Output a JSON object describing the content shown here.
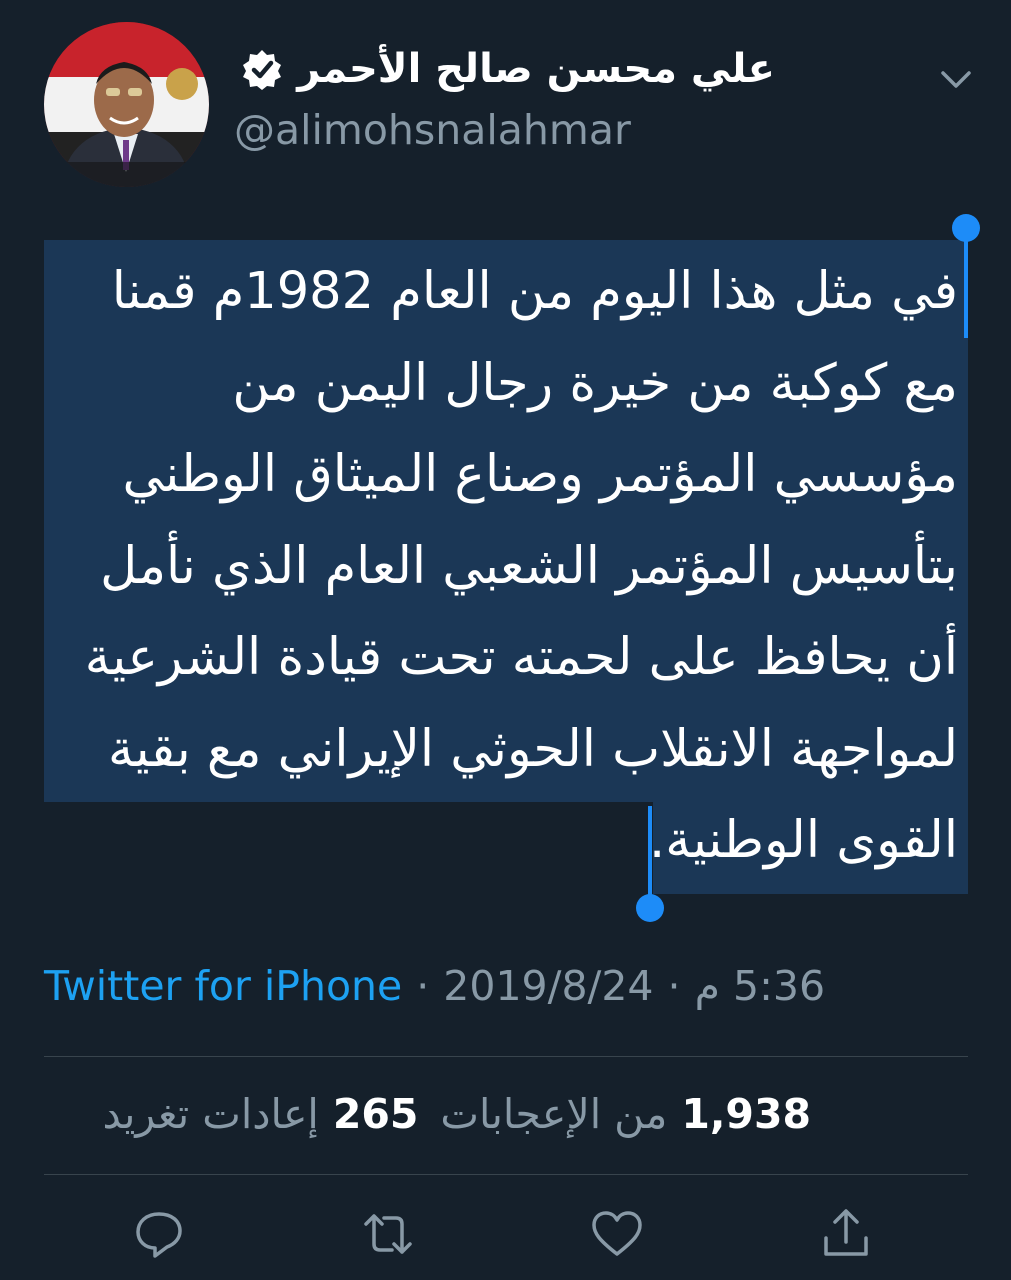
{
  "header": {
    "display_name": "علي محسن صالح الأحمر",
    "handle": "@alimohsnalahmar"
  },
  "tweet": {
    "lines": [
      "في مثل هذا اليوم من العام 1982م قمنا",
      "مع كوكبة من خيرة رجال اليمن من",
      "مؤسسي المؤتمر وصناع الميثاق الوطني",
      "بتأسيس المؤتمر الشعبي العام الذي نأمل",
      "أن يحافظ على لحمته تحت قيادة الشرعية",
      "لمواجهة الانقلاب الحوثي الإيراني مع بقية",
      "القوى الوطنية."
    ]
  },
  "meta": {
    "source": "Twitter for iPhone",
    "separator": "·",
    "date": "2019/8/24",
    "time": "5:36 م"
  },
  "stats": {
    "likes_count": "1,938",
    "likes_label": "من الإعجابات",
    "retweets_count": "265",
    "retweets_label": "إعادات تغريد"
  },
  "icons": {
    "avatar": "profile-photo",
    "verified": "verified-badge-icon",
    "more": "chevron-down-icon",
    "reply": "reply-icon",
    "retweet": "retweet-icon",
    "like": "heart-icon",
    "share": "share-icon"
  },
  "colors": {
    "background": "#15202b",
    "accent": "#1da1f2",
    "selection": "#1b3756",
    "muted": "#8899a6",
    "divider": "#38444d"
  }
}
